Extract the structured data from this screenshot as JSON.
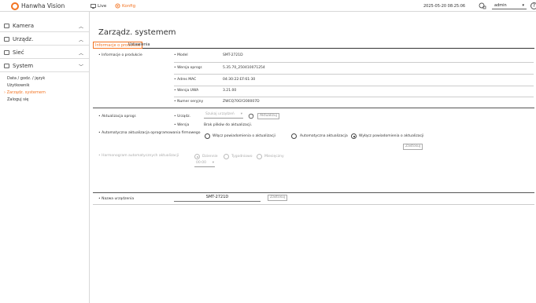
{
  "header": {
    "logo_text": "Hanwha Vision",
    "nav_live": "Live",
    "nav_config": "Konfig",
    "datetime": "2025-05-20 08:25:06",
    "user": "admin",
    "help_glyph": "?"
  },
  "sidebar": {
    "items": [
      {
        "label": "Kamera",
        "icon": "camera-icon"
      },
      {
        "label": "Urządz.",
        "icon": "device-icon"
      },
      {
        "label": "Sieć",
        "icon": "network-icon"
      },
      {
        "label": "System",
        "icon": "system-icon"
      }
    ],
    "sub_items": [
      "Data / godz. / język",
      "Użytkownik",
      "Zarządz. systemem",
      "Zaloguj się"
    ],
    "active_sub": "Zarządz. systemem"
  },
  "page": {
    "title": "Zarządz. systemem",
    "tabs": [
      "Informacje o produkcie",
      "Ustawienia"
    ],
    "product_info_label": "Informacje o produkcie",
    "fields": [
      {
        "label": "Model",
        "value": "SMT-2721D"
      },
      {
        "label": "Wersja oprogr.",
        "value": "5.35.70_250410071254"
      },
      {
        "label": "Adres MAC",
        "value": "04:30:22:EF:61:30"
      },
      {
        "label": "Wersja UWA",
        "value": "3.21.00"
      },
      {
        "label": "Numer seryjny",
        "value": "ZWCQ70GY200007D"
      }
    ],
    "fw_update_label": "Aktualizacja oprogr.",
    "fw_device_label": "Urządz.",
    "fw_device_placeholder": "Szukaj urządzeń",
    "fw_update_button": "Aktualizuj",
    "fw_version_label": "Wersja",
    "fw_version_value": "Brak plików do aktualizacji.",
    "auto_update_label": "Automatyczna aktualizacja oprogramowania firmowego",
    "auto_update_options": [
      "Włącz powiadomienia o aktualizacji",
      "Automatyczna aktualizacja",
      "Wyłącz powiadomienia o aktualizacji"
    ],
    "auto_update_selected": 2,
    "apply_button": "Zastosuj",
    "schedule_label": "Harmonogram automatycznych aktualizacji",
    "schedule_options": [
      "Dziennie",
      "Tygodniowo",
      "Miesięczny"
    ],
    "schedule_selected": 0,
    "schedule_time": "00:00",
    "device_name_label": "Nazwa urządzenia",
    "device_name_value": "SMT-2721D",
    "device_name_apply": "Zastosuj"
  }
}
